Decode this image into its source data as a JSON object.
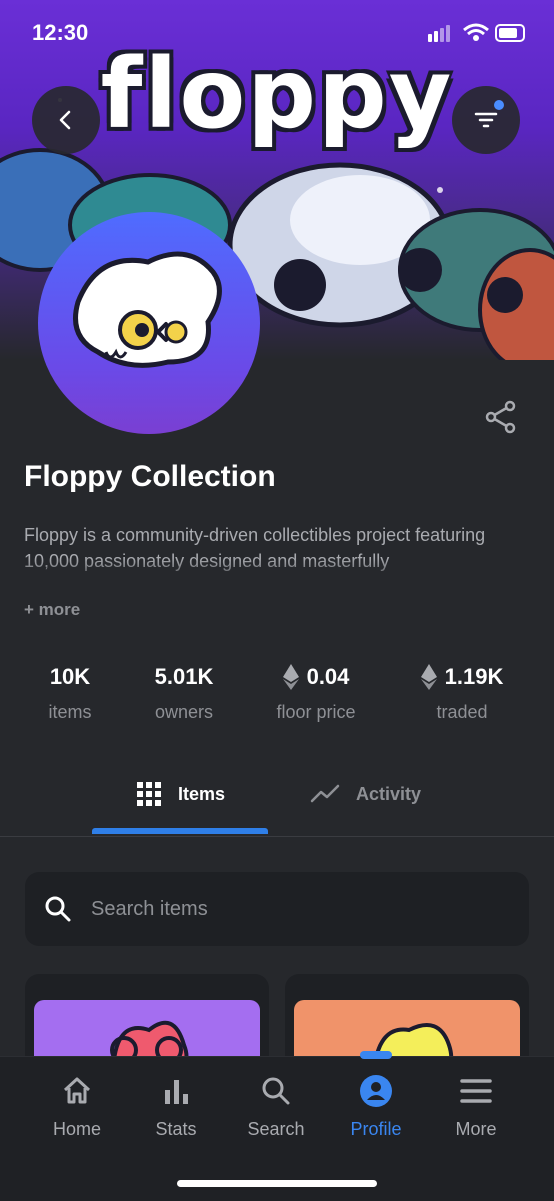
{
  "status_bar": {
    "time": "12:30"
  },
  "banner": {
    "logo_text": "floppy"
  },
  "collection": {
    "title": "Floppy Collection",
    "description": "Floppy is a community-driven collectibles project featuring 10,000 passionately designed and masterfully",
    "more_label": "+ more"
  },
  "stats": [
    {
      "value": "10K",
      "label": "items"
    },
    {
      "value": "5.01K",
      "label": "owners"
    },
    {
      "value": "0.04",
      "label": "floor price",
      "icon": "ethereum-icon"
    },
    {
      "value": "1.19K",
      "label": "traded",
      "icon": "ethereum-icon"
    }
  ],
  "tabs": [
    {
      "label": "Items",
      "icon": "grid-icon",
      "active": true
    },
    {
      "label": "Activity",
      "icon": "trend-icon",
      "active": false
    }
  ],
  "search": {
    "placeholder": "Search items"
  },
  "bottom_nav": [
    {
      "label": "Home",
      "icon": "home-icon"
    },
    {
      "label": "Stats",
      "icon": "stats-icon"
    },
    {
      "label": "Search",
      "icon": "search-icon"
    },
    {
      "label": "Profile",
      "icon": "profile-icon",
      "active": true
    },
    {
      "label": "More",
      "icon": "menu-icon"
    }
  ],
  "colors": {
    "accent": "#3a86f0",
    "background": "#26282c",
    "card": "#1e2024",
    "banner": "#5a26c2"
  }
}
